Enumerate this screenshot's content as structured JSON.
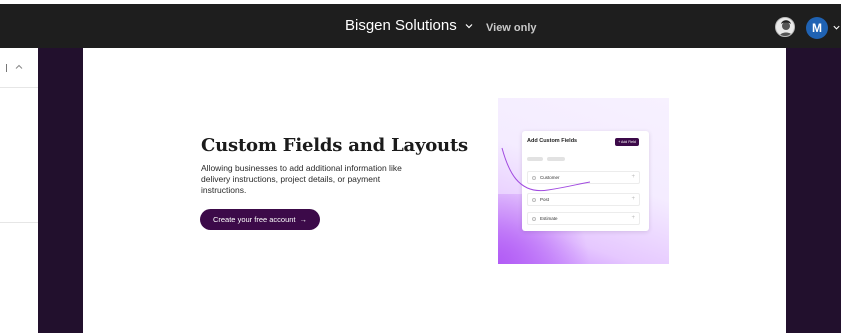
{
  "topbar": {
    "title": "Bisgen Solutions",
    "view_mode": "View only",
    "avatar_initial": "M",
    "avatar_color": "#1f62b3"
  },
  "hero": {
    "heading": "Custom Fields and Layouts",
    "description": "Allowing businesses to add additional information like delivery instructions, project details, or payment instructions.",
    "cta_label": "Create your free account",
    "cta_arrow": "→"
  },
  "illustration": {
    "card_title": "Add Custom Fields",
    "card_button": "+ Add Field",
    "fields": [
      "Customer",
      "Post",
      "Estimate"
    ]
  },
  "colors": {
    "topbar": "#1e1e1e",
    "side_bars": "#22102d",
    "brand_purple": "#3c0a49",
    "gradient_purple": "#c788ff"
  }
}
